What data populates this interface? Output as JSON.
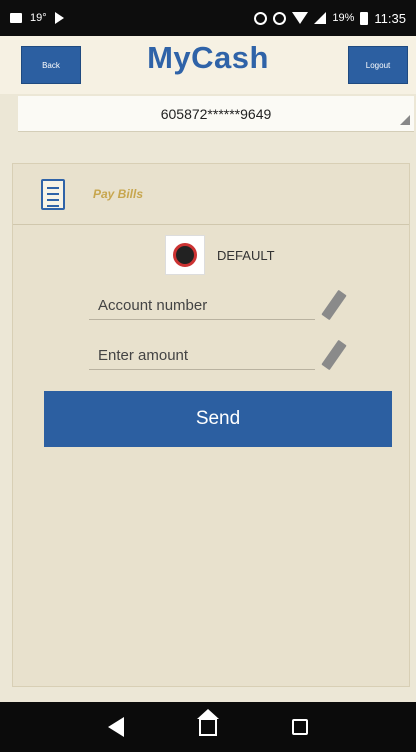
{
  "status_bar": {
    "left_text": "19°",
    "battery_text": "19%",
    "time": "11:35"
  },
  "header": {
    "back_label": "Back",
    "title": "MyCash",
    "logout_label": "Logout"
  },
  "account": {
    "number": "605872******9649"
  },
  "pay_bills": {
    "title": "Pay Bills",
    "biller_name": "DEFAULT",
    "account_placeholder": "Account number",
    "amount_placeholder": "Enter amount",
    "send_label": "Send"
  }
}
